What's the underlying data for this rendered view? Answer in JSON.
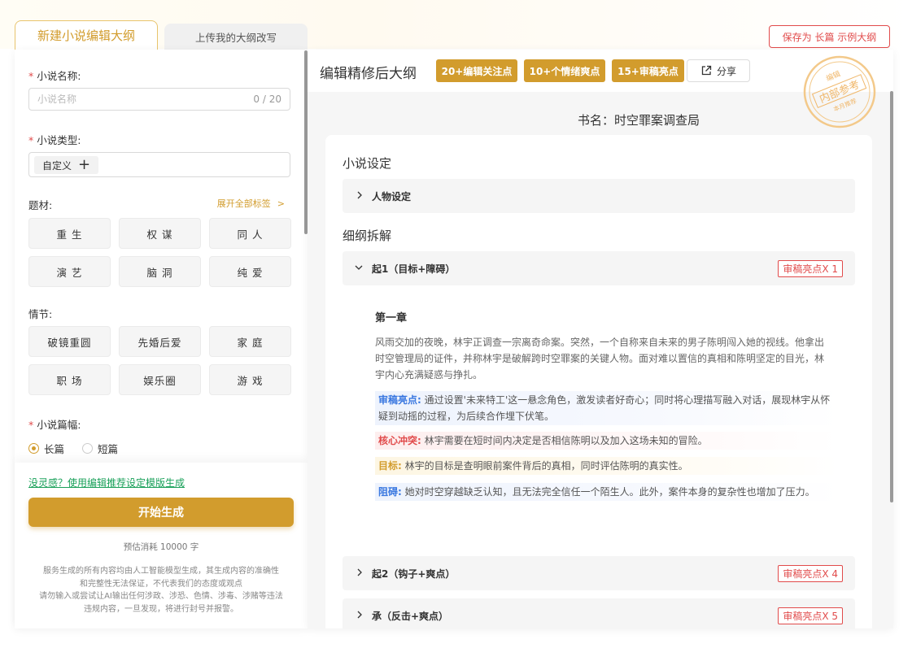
{
  "tabs": {
    "active": "新建小说编辑大纲",
    "inactive": "上传我的大纲改写"
  },
  "save_button": "保存为 长篇 示例大纲",
  "form": {
    "name_label": "小说名称:",
    "name_placeholder": "小说名称",
    "name_counter": "0 / 20",
    "type_label": "小说类型:",
    "type_tag": "自定义",
    "theme_label": "题材:",
    "expand_link": "展开全部标签",
    "themes": [
      "重 生",
      "权 谋",
      "同 人",
      "演 艺",
      "脑 洞",
      "纯 爱"
    ],
    "plot_label": "情节:",
    "plots": [
      "破镜重圆",
      "先婚后爱",
      "家 庭",
      "职 场",
      "娱乐圈",
      "游 戏"
    ],
    "length_label": "小说篇幅:",
    "length_options": [
      "长篇",
      "短篇"
    ],
    "length_selected": "长篇",
    "inspire_link": "没灵感？使用编辑推荐设定模版生成",
    "generate_button": "开始生成",
    "cost": "预估消耗 10000 字",
    "disclaimer": [
      "服务生成的所有内容均由人工智能模型生成，其生成内容的准确性",
      "和完整性无法保证，不代表我们的态度或观点",
      "请勿输入或尝试让AI输出任何涉政、涉恐、色情、涉毒、涉赌等违法",
      "违规内容，一旦发现，将进行封号并报警。"
    ]
  },
  "outline": {
    "header_title": "编辑精修后大纲",
    "badges": [
      "20+编辑关注点",
      "10+个情绪爽点",
      "15+审稿亮点"
    ],
    "share": "分享",
    "stamp": {
      "top": "编辑",
      "main": "内部参考",
      "bottom": "本月推荐"
    },
    "book_title": "书名：时空罪案调查局",
    "setting_heading": "小说设定",
    "setting_item": "人物设定",
    "breakdown_heading": "细纲拆解",
    "sections": [
      {
        "label": "起1（目标+障碍）",
        "badge": "审稿亮点X 1",
        "expanded": true
      },
      {
        "label": "起2（钩子+爽点）",
        "badge": "审稿亮点X 4",
        "expanded": false
      },
      {
        "label": "承（反击+爽点）",
        "badge": "审稿亮点X 5",
        "expanded": false
      }
    ],
    "chapter": {
      "title": "第一章",
      "body": "风雨交加的夜晚，林宇正调查一宗离奇命案。突然，一个自称来自未来的男子陈明闯入她的视线。他拿出时空管理局的证件，并称林宇是破解跨时空罪案的关键人物。面对难以置信的真相和陈明坚定的目光，林宇内心充满疑惑与挣扎。",
      "notes": [
        {
          "key": "审稿亮点:",
          "text": "通过设置'未来特工'这一悬念角色，激发读者好奇心；同时将心理描写融入对话，展现林宇从怀疑到动摇的过程，为后续合作埋下伏笔。",
          "color": "#3a78e0"
        },
        {
          "key": "核心冲突:",
          "text": "林宇需要在短时间内决定是否相信陈明以及加入这场未知的冒险。",
          "color": "#e14b4b"
        },
        {
          "key": "目标:",
          "text": "林宇的目标是查明眼前案件背后的真相，同时评估陈明的真实性。",
          "color": "#d29c2d"
        },
        {
          "key": "阻碍:",
          "text": "她对时空穿越缺乏认知，且无法完全信任一个陌生人。此外，案件本身的复杂性也增加了压力。",
          "color": "#3a78e0"
        }
      ]
    }
  },
  "colors": {
    "accent": "#d29c2d",
    "danger": "#e14b4b",
    "link_green": "#18a058",
    "note_blue": "#3a78e0"
  }
}
